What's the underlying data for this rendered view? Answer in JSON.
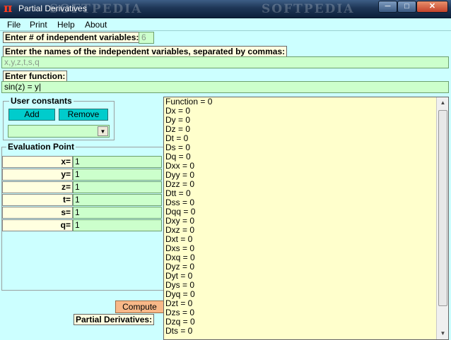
{
  "window": {
    "title": "Partial Derivatives",
    "watermark": "SOFTPEDIA",
    "min_glyph": "─",
    "max_glyph": "□",
    "close_glyph": "✕"
  },
  "menu": [
    "File",
    "Print",
    "Help",
    "About"
  ],
  "num_vars": {
    "label": "Enter # of independent variables:",
    "value": "6"
  },
  "var_names": {
    "label": "Enter the names of the independent variables, separated by commas:",
    "value": "x,y,z,t,s,q"
  },
  "function": {
    "label": "Enter function:",
    "value": "sin(z) = y|"
  },
  "user_constants": {
    "title": "User constants",
    "add_label": "Add",
    "remove_label": "Remove",
    "selected": ""
  },
  "eval_point": {
    "title": "Evaluation Point",
    "vars": [
      {
        "name": "x=",
        "value": "1"
      },
      {
        "name": "y=",
        "value": "1"
      },
      {
        "name": "z=",
        "value": "1"
      },
      {
        "name": "t=",
        "value": "1"
      },
      {
        "name": "s=",
        "value": "1"
      },
      {
        "name": "q=",
        "value": "1"
      }
    ]
  },
  "compute_label": "Compute",
  "partials_label": "Partial Derivatives:",
  "results": [
    "Function = 0",
    "Dx = 0",
    "Dy = 0",
    "Dz = 0",
    "Dt = 0",
    "Ds = 0",
    "Dq = 0",
    "Dxx = 0",
    "Dyy = 0",
    "Dzz = 0",
    "Dtt = 0",
    "Dss = 0",
    "Dqq = 0",
    "Dxy = 0",
    "Dxz = 0",
    "Dxt = 0",
    "Dxs = 0",
    "Dxq = 0",
    "Dyz = 0",
    "Dyt = 0",
    "Dys = 0",
    "Dyq = 0",
    "Dzt = 0",
    "Dzs = 0",
    "Dzq = 0",
    "Dts = 0"
  ],
  "colors": {
    "background": "#ccffff",
    "field": "#ccffcc",
    "label": "#ffffe0",
    "results": "#ffffcc",
    "accent_button": "#00cccc",
    "compute_button": "#f8b888"
  }
}
